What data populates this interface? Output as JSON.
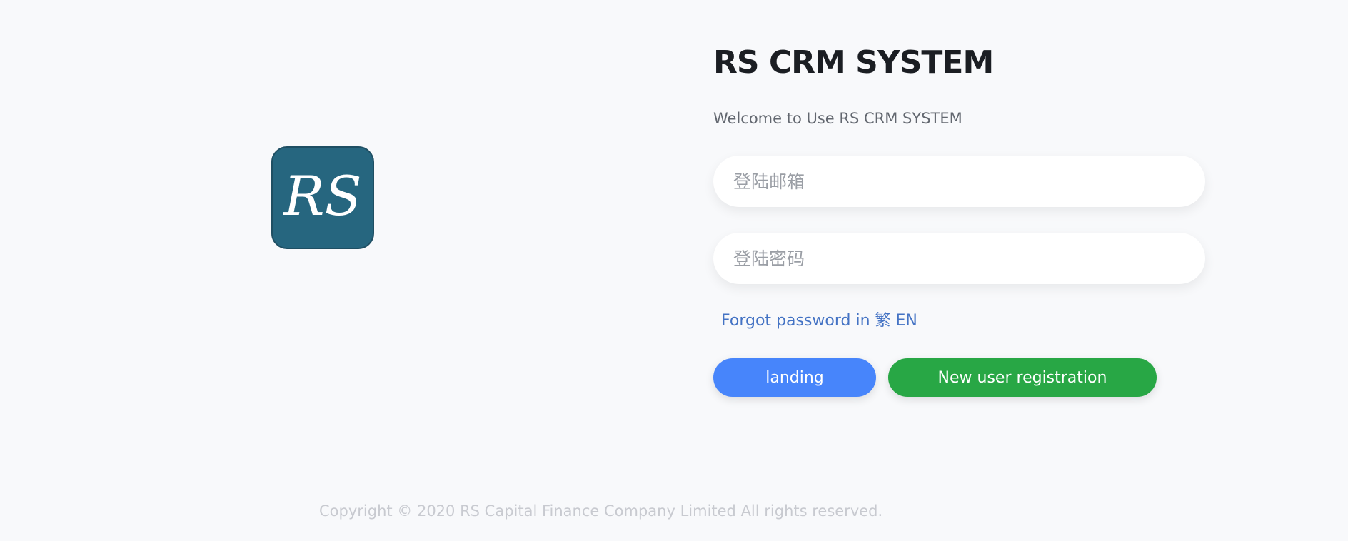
{
  "logo": {
    "text": "RS",
    "background": "#26667f"
  },
  "header": {
    "title": "RS CRM SYSTEM",
    "subtitle": "Welcome to Use RS CRM SYSTEM"
  },
  "form": {
    "email_placeholder": "登陆邮箱",
    "password_placeholder": "登陆密码",
    "forgot_link": "Forgot password in 繁 EN",
    "login_label": "landing",
    "register_label": "New user registration"
  },
  "footer": {
    "copyright": "Copyright © 2020 RS Capital Finance Company Limited All rights reserved."
  },
  "colors": {
    "primary": "#4785fb",
    "success": "#28a745",
    "link": "#4473c4"
  }
}
